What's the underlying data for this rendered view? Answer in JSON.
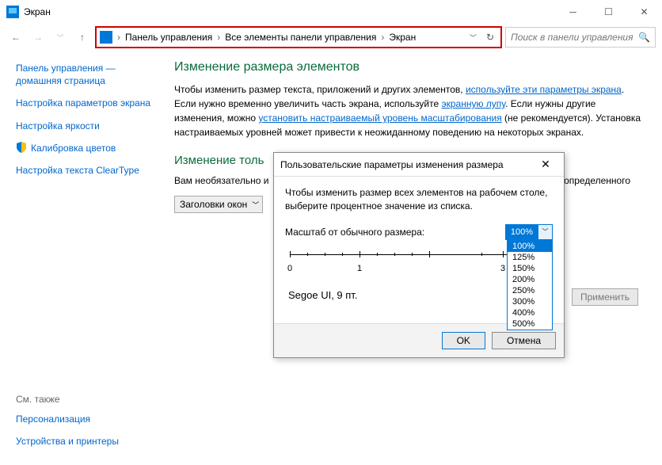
{
  "window": {
    "title": "Экран"
  },
  "breadcrumb": {
    "items": [
      "Панель управления",
      "Все элементы панели управления",
      "Экран"
    ]
  },
  "search": {
    "placeholder": "Поиск в панели управления"
  },
  "sidebar": {
    "home": "Панель управления — домашняя страница",
    "links": [
      "Настройка параметров экрана",
      "Настройка яркости",
      "Калибровка цветов",
      "Настройка текста ClearType"
    ],
    "see_also_hdr": "См. также",
    "see_also": [
      "Персонализация",
      "Устройства и принтеры"
    ]
  },
  "main": {
    "h1": "Изменение размера элементов",
    "p1a": "Чтобы изменить размер текста, приложений и других элементов, ",
    "p1link": "используйте эти параметры экрана",
    "p2a": "Если нужно временно увеличить часть экрана, используйте ",
    "p2link": "экранную лупу",
    "p2b": ". Если нужны другие изменения, можно ",
    "p2link2": "установить настраиваемый уровень масштабирования",
    "p2c": " (не рекомендуется). Установка настраиваемых уровней может привести к неожиданному поведению на некоторых экранах.",
    "h2": "Изменение толь",
    "p3a": "Вам необязательно и",
    "p3b": "только размер текста определенного",
    "combo_label": "Заголовки окон",
    "apply": "Применить"
  },
  "dialog": {
    "title": "Пользовательские параметры изменения размера",
    "body": "Чтобы изменить размер всех элементов на рабочем столе, выберите процентное значение из списка.",
    "scale_label": "Масштаб от обычного размера:",
    "scale_value": "100%",
    "options": [
      "100%",
      "125%",
      "150%",
      "200%",
      "250%",
      "300%",
      "400%",
      "500%"
    ],
    "ruler": {
      "marks": [
        "0",
        "1",
        "3"
      ]
    },
    "font_sample": "Segoe UI, 9 пт.",
    "ok": "OK",
    "cancel": "Отмена"
  }
}
